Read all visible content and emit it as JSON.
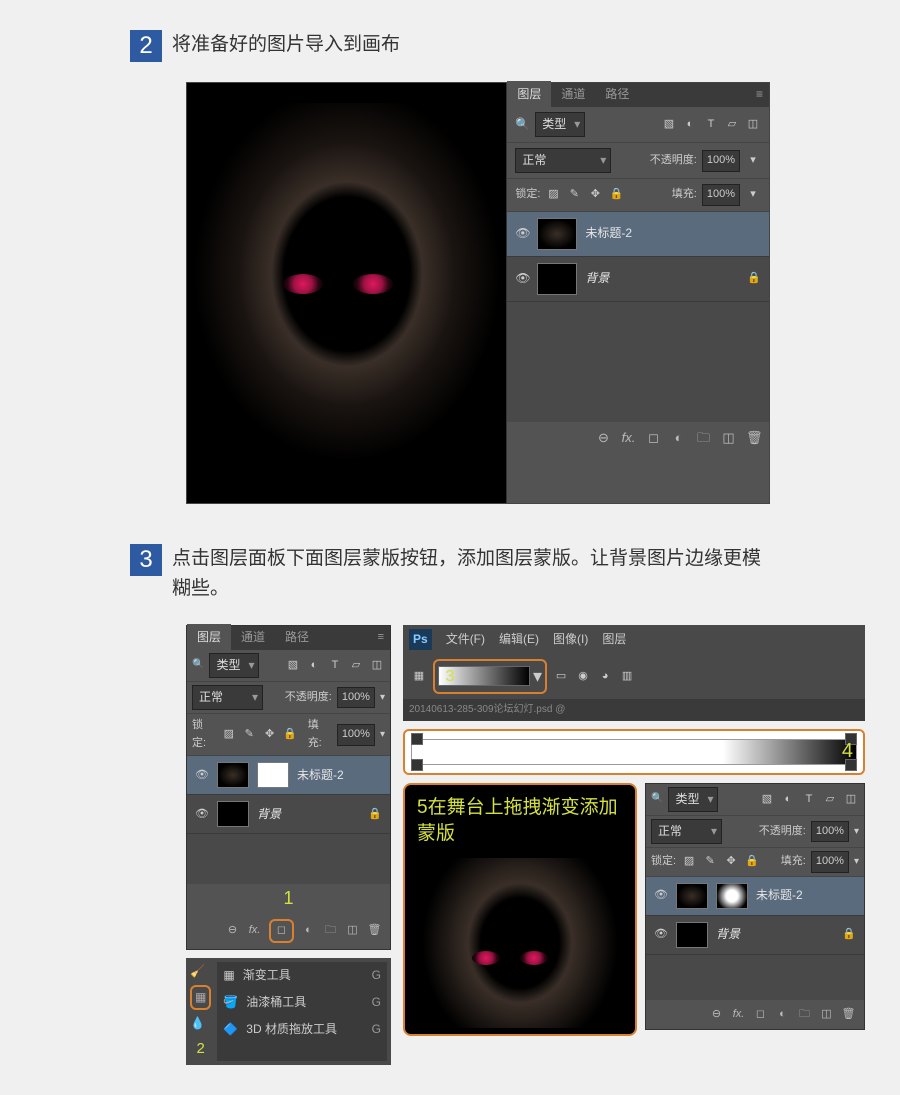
{
  "step2": {
    "num": "2",
    "text": "将准备好的图片导入到画布"
  },
  "step3": {
    "num": "3",
    "text": "点击图层面板下面图层蒙版按钮，添加图层蒙版。让背景图片边缘更模糊些。"
  },
  "panel": {
    "tabs": {
      "layers": "图层",
      "channels": "通道",
      "paths": "路径"
    },
    "filter": "类型",
    "blend": "正常",
    "opacity_lbl": "不透明度:",
    "opacity_val": "100%",
    "lock_lbl": "锁定:",
    "fill_lbl": "填充:",
    "fill_val": "100%",
    "layer1": "未标题-2",
    "layer_bg": "背景"
  },
  "tools": {
    "annot2": "2",
    "gradient": "渐变工具",
    "paint": "油漆桶工具",
    "drop": "3D 材质拖放工具",
    "key": "G"
  },
  "menu": {
    "file": "文件(F)",
    "edit": "编辑(E)",
    "image": "图像(I)",
    "layer": "图层"
  },
  "tab_doc": "20140613-285-309论坛幻灯.psd @",
  "annot": {
    "n1": "1",
    "n3": "3",
    "n4": "4",
    "stage": "5在舞台上拖拽渐变添加蒙版"
  }
}
